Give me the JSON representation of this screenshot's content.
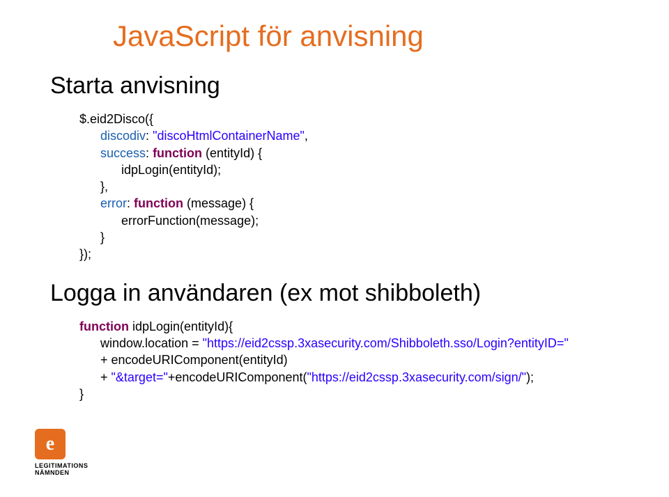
{
  "title": "JavaScript för anvisning",
  "section1": {
    "heading": "Starta anvisning",
    "code": {
      "l1a": "$.eid2Disco({",
      "l2a": "discodiv",
      "l2b": ": ",
      "l2c": "\"discoHtmlContainerName\"",
      "l2d": ",",
      "l3a": "success",
      "l3b": ": ",
      "l3c": "function",
      "l3d": " (entityId) {",
      "l4a": "idpLogin(entityId);",
      "l5a": "},",
      "l6a": "error",
      "l6b": ": ",
      "l6c": "function",
      "l6d": " (message) {",
      "l7a": "errorFunction(message);",
      "l8a": "}",
      "l9a": "});"
    }
  },
  "section2": {
    "heading": "Logga in användaren (ex mot shibboleth)",
    "code": {
      "l1a": "function",
      "l1b": " idpLogin(entityId){",
      "l2a": "window.location = ",
      "l2b": "\"https://eid2cssp.3xasecurity.com/Shibboleth.sso/Login?entityID=\"",
      "l3a": "+ encodeURIComponent(entityId)",
      "l4a": "+ ",
      "l4b": "\"&target=\"",
      "l4c": "+encodeURIComponent(",
      "l4d": "\"https://eid2cssp.3xasecurity.com/sign/\"",
      "l4e": ");",
      "l5a": "}"
    }
  },
  "logo": {
    "glyph": "e",
    "line1": "LEGITIMATIONS",
    "line2": "NÄMNDEN"
  }
}
